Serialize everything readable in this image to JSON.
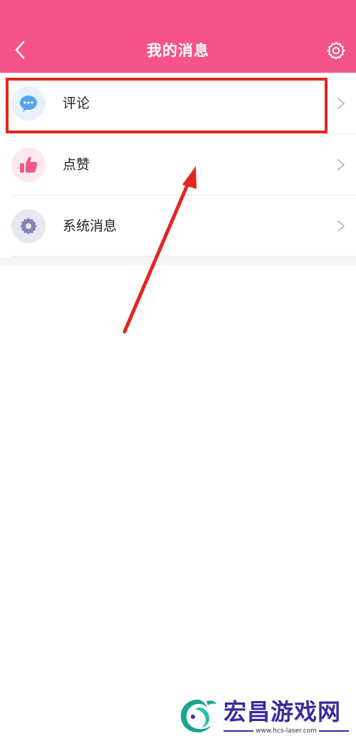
{
  "header": {
    "title": "我的消息",
    "background_color": "#f5538a",
    "back_icon": "chevron-left-icon",
    "settings_icon": "gear-icon"
  },
  "messages": {
    "items": [
      {
        "label": "评论",
        "icon": "chat-bubble-icon",
        "icon_color": "#5aa3ec"
      },
      {
        "label": "点赞",
        "icon": "thumbs-up-icon",
        "icon_color": "#f0588e"
      },
      {
        "label": "系统消息",
        "icon": "gear-icon",
        "icon_color": "#8285b6"
      }
    ]
  },
  "annotation": {
    "highlight_color": "#e0281e",
    "highlighted_item": "评论"
  },
  "watermark": {
    "brand": "宏昌游戏网",
    "url": "www.hcs-laser.com",
    "color": "#3d2a9c"
  }
}
